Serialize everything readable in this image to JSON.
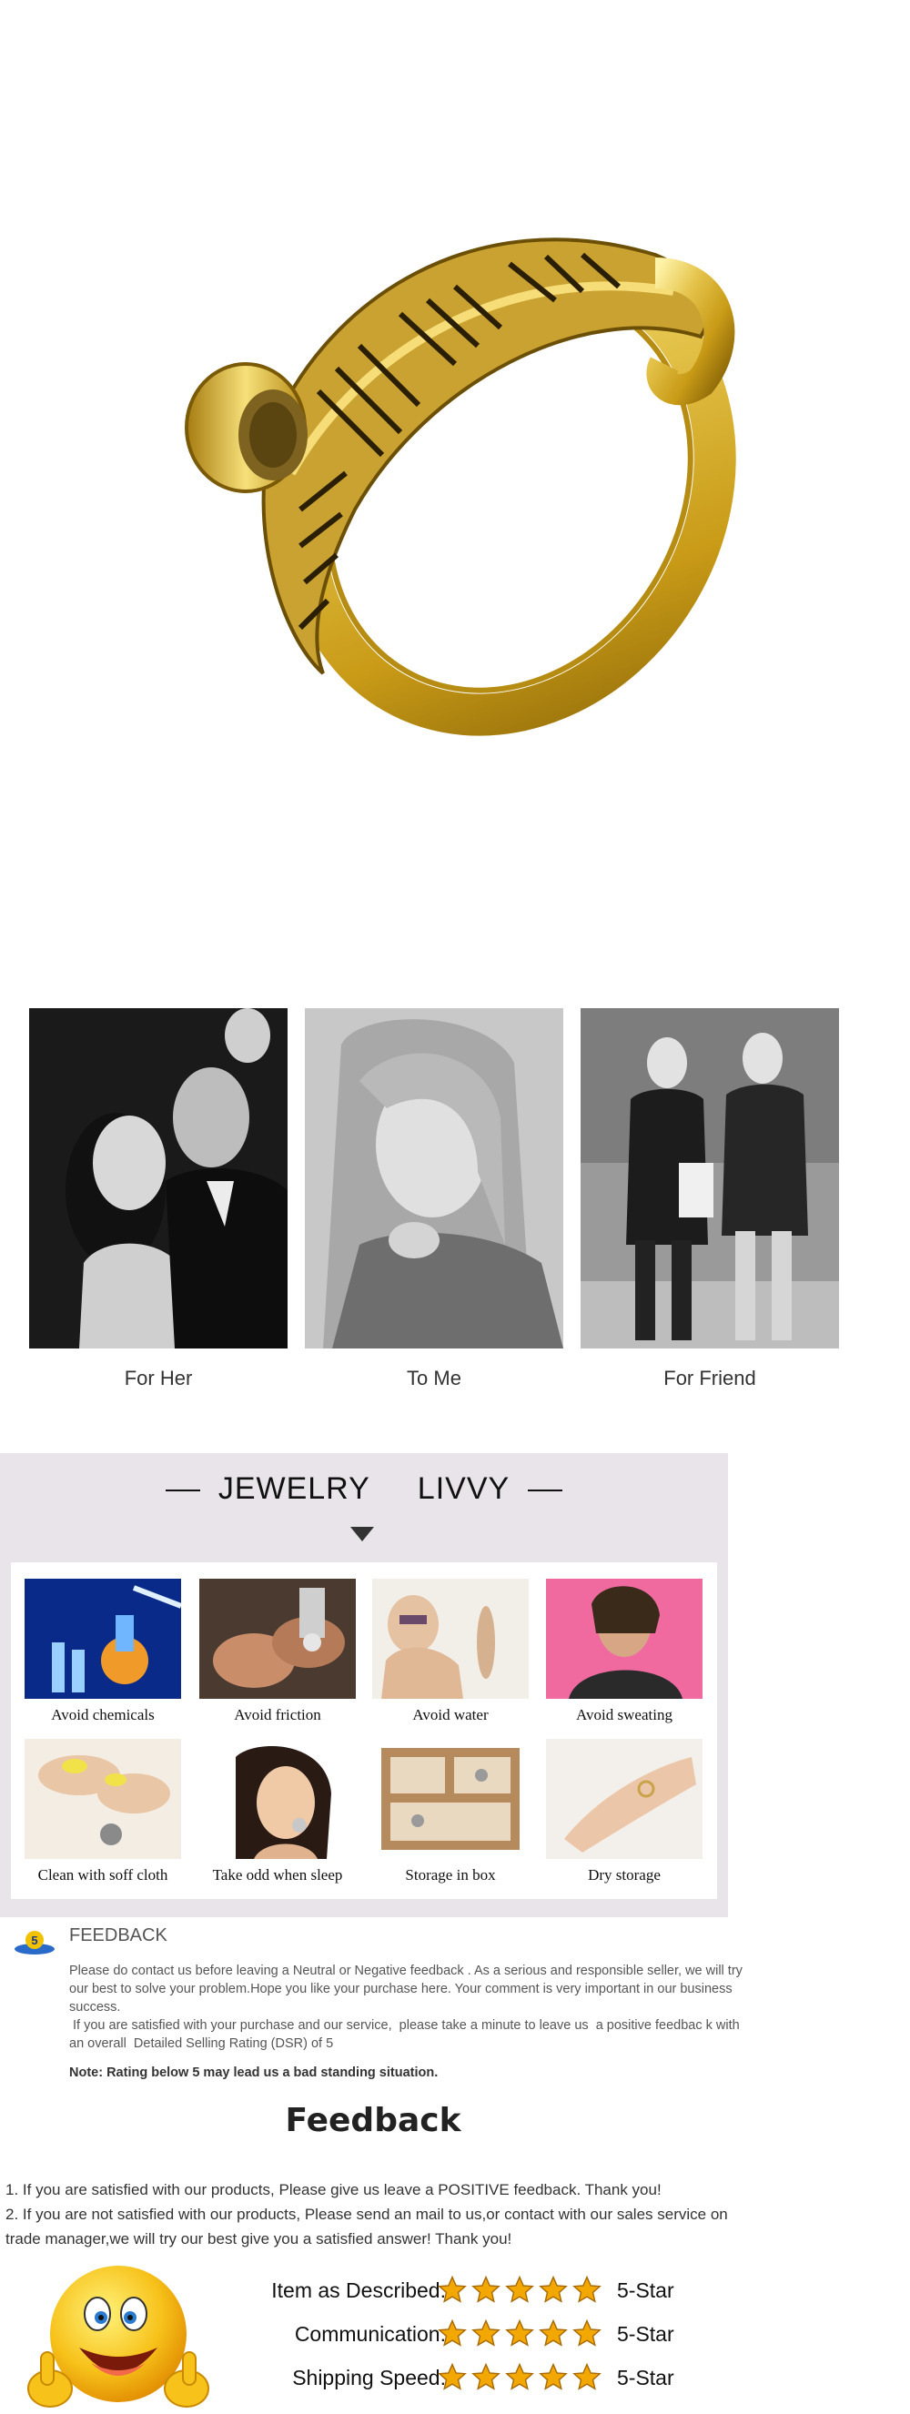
{
  "photos": [
    {
      "caption": "For Her"
    },
    {
      "caption": "To Me"
    },
    {
      "caption": "For Friend"
    }
  ],
  "care": {
    "brand_left": "JEWELRY",
    "brand_right": "LIVVY",
    "tips": [
      {
        "label": "Avoid chemicals",
        "icon": "chemicals-icon"
      },
      {
        "label": "Avoid friction",
        "icon": "friction-icon"
      },
      {
        "label": "Avoid water",
        "icon": "water-icon"
      },
      {
        "label": "Avoid sweating",
        "icon": "sweating-icon"
      },
      {
        "label": "Clean with soff cloth",
        "icon": "cloth-icon"
      },
      {
        "label": "Take odd when sleep",
        "icon": "sleep-icon"
      },
      {
        "label": "Storage in box",
        "icon": "box-icon"
      },
      {
        "label": "Dry storage",
        "icon": "dry-icon"
      }
    ]
  },
  "notice": {
    "badge": "5",
    "title": "FEEDBACK",
    "paragraph_1": "Please do contact us before leaving a Neutral or Negative  feedback . As a serious and responsible seller, we will try our best to solve your problem.Hope you like your purchase here. Your comment is very important in our business success.",
    "paragraph_2": " If you are satisfied with your purchase and our service,  please take a minute to leave us  a positive feedbac k with an overall  Detailed Selling Rating (DSR) of 5",
    "note": "Note: Rating below 5 may lead us a bad standing situation."
  },
  "feedback": {
    "heading": "Feedback",
    "line_1": "1. If you are satisfied with our products, Please give us leave a POSITIVE feedback. Thank you!",
    "line_2": "2. If you are not satisfied with our products, Please send an mail to us,or contact with our sales service on trade manager,we will try our best give you a satisfied answer! Thank you!",
    "ratings": [
      {
        "label": "Item as Described:",
        "stars": 5,
        "value": "5-Star"
      },
      {
        "label": "Communication:",
        "stars": 5,
        "value": "5-Star"
      },
      {
        "label": "Shipping Speed:",
        "stars": 5,
        "value": "5-Star"
      }
    ],
    "star_color": "#f2a800"
  }
}
